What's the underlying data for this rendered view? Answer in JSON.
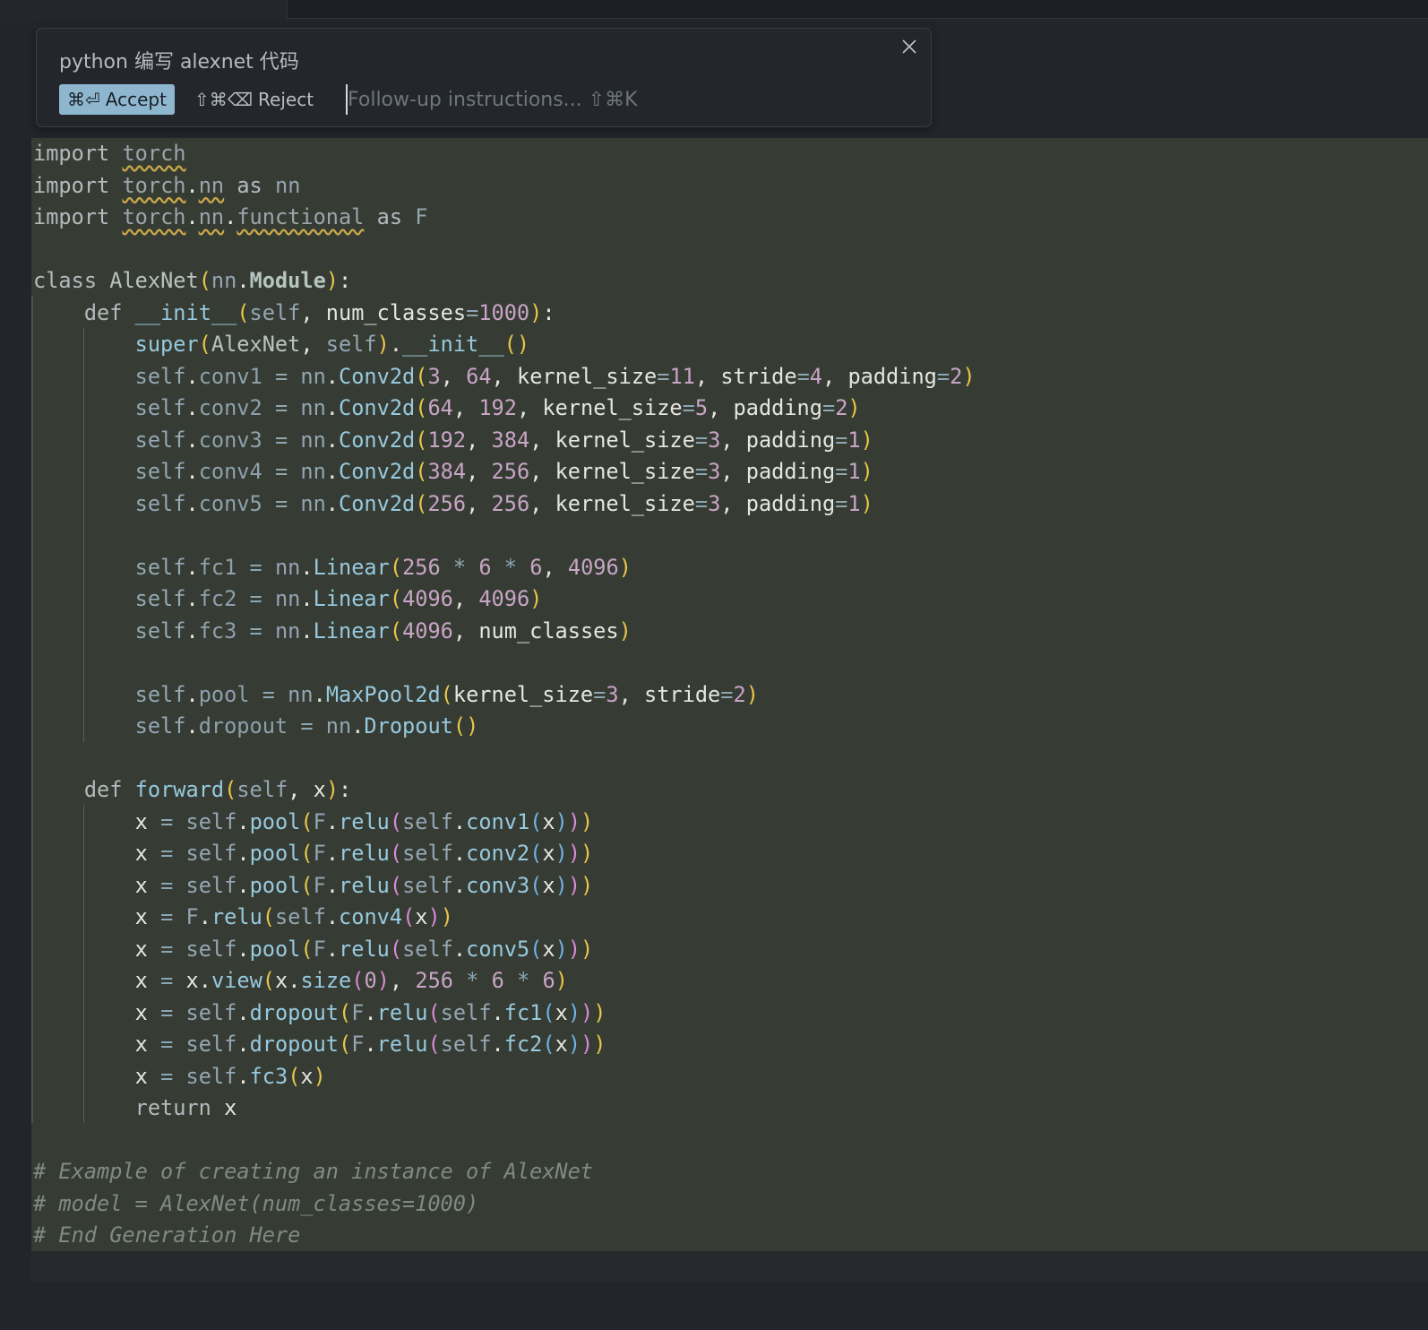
{
  "prompt_panel": {
    "title": "python 编写 alexnet 代码",
    "accept": {
      "shortcut": "⌘⏎",
      "label": "Accept"
    },
    "reject": {
      "shortcut": "⇧⌘⌫",
      "label": "Reject"
    },
    "followup_placeholder": "Follow-up instructions... ⇧⌘K",
    "close_icon": "close-icon"
  },
  "editor": {
    "language": "python",
    "colors": {
      "diff_background": "#363c33",
      "accent_button": "#8eb7cf",
      "warning_squiggle": "#c8a84a"
    },
    "lines": [
      "import torch",
      "import torch.nn as nn",
      "import torch.nn.functional as F",
      "",
      "class AlexNet(nn.Module):",
      "    def __init__(self, num_classes=1000):",
      "        super(AlexNet, self).__init__()",
      "        self.conv1 = nn.Conv2d(3, 64, kernel_size=11, stride=4, padding=2)",
      "        self.conv2 = nn.Conv2d(64, 192, kernel_size=5, padding=2)",
      "        self.conv3 = nn.Conv2d(192, 384, kernel_size=3, padding=1)",
      "        self.conv4 = nn.Conv2d(384, 256, kernel_size=3, padding=1)",
      "        self.conv5 = nn.Conv2d(256, 256, kernel_size=3, padding=1)",
      "",
      "        self.fc1 = nn.Linear(256 * 6 * 6, 4096)",
      "        self.fc2 = nn.Linear(4096, 4096)",
      "        self.fc3 = nn.Linear(4096, num_classes)",
      "",
      "        self.pool = nn.MaxPool2d(kernel_size=3, stride=2)",
      "        self.dropout = nn.Dropout()",
      "",
      "    def forward(self, x):",
      "        x = self.pool(F.relu(self.conv1(x)))",
      "        x = self.pool(F.relu(self.conv2(x)))",
      "        x = self.pool(F.relu(self.conv3(x)))",
      "        x = F.relu(self.conv4(x))",
      "        x = self.pool(F.relu(self.conv5(x)))",
      "        x = x.view(x.size(0), 256 * 6 * 6)",
      "        x = self.dropout(F.relu(self.fc1(x)))",
      "        x = self.dropout(F.relu(self.fc2(x)))",
      "        x = self.fc3(x)",
      "        return x",
      "",
      "# Example of creating an instance of AlexNet",
      "# model = AlexNet(num_classes=1000)",
      "# End Generation Here"
    ]
  }
}
